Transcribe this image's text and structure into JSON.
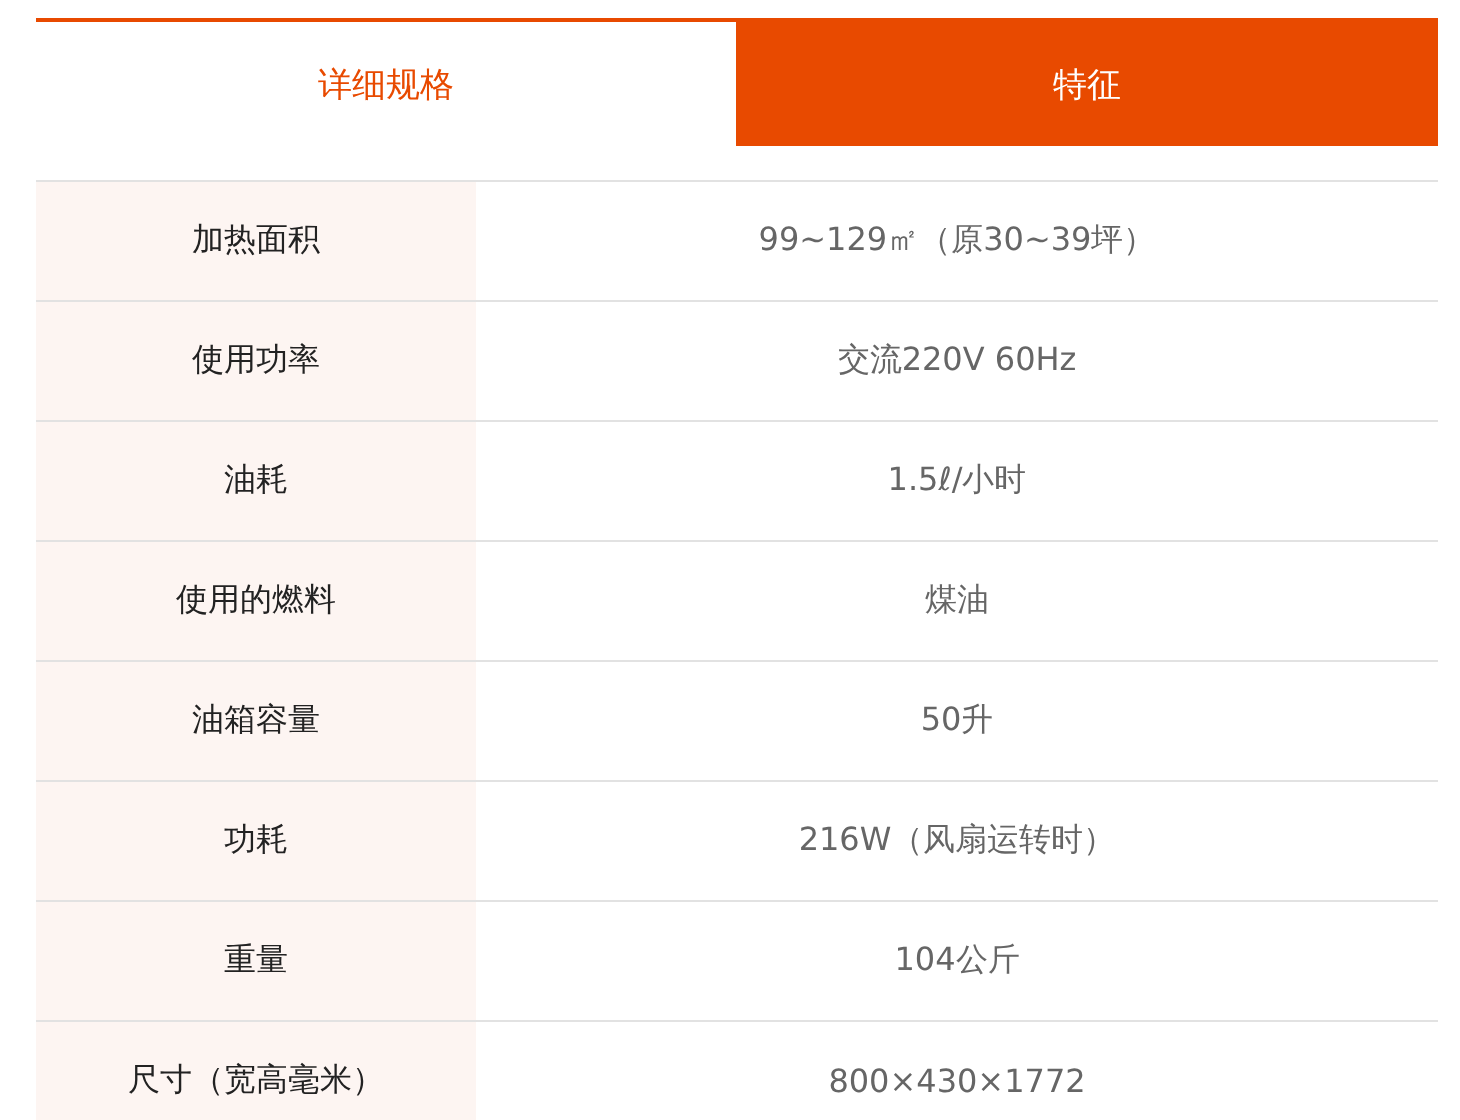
{
  "tabs": [
    {
      "label": "详细规格",
      "selected": false
    },
    {
      "label": "特征",
      "selected": true
    }
  ],
  "specs": [
    {
      "label": "加热面积",
      "value": "99~129㎡（原30~39坪）"
    },
    {
      "label": "使用功率",
      "value": "交流220V 60Hz"
    },
    {
      "label": "油耗",
      "value": "1.5ℓ/小时"
    },
    {
      "label": "使用的燃料",
      "value": "煤油"
    },
    {
      "label": "油箱容量",
      "value": "50升"
    },
    {
      "label": "功耗",
      "value": "216W（风扇运转时）"
    },
    {
      "label": "重量",
      "value": "104公斤"
    },
    {
      "label": "尺寸（宽高毫米）",
      "value": "800×430×1772"
    }
  ]
}
